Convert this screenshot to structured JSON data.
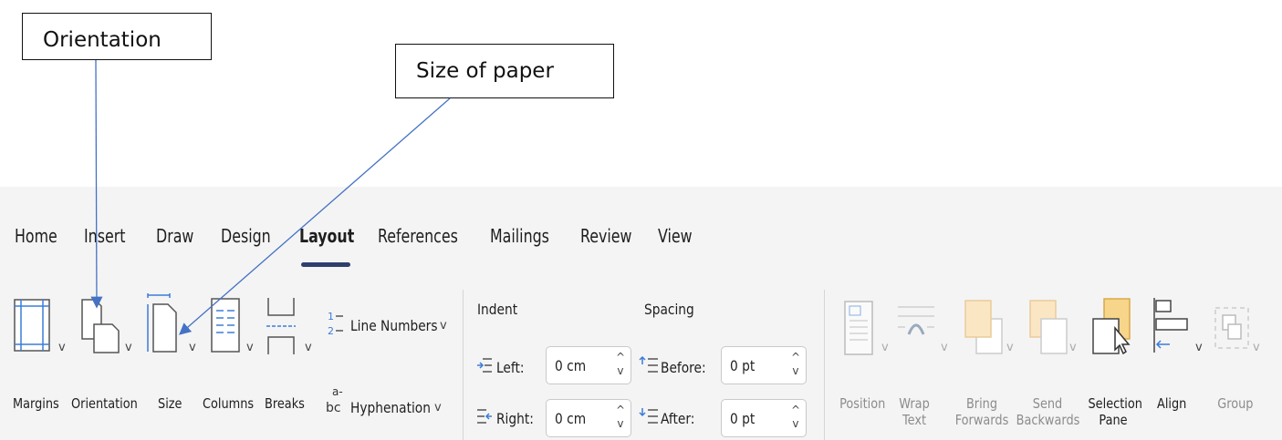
{
  "callouts": {
    "orientation": "Orientation",
    "size_of_paper": "Size of paper"
  },
  "tabs": [
    "Home",
    "Insert",
    "Draw",
    "Design",
    "Layout",
    "References",
    "Mailings",
    "Review",
    "View"
  ],
  "active_tab": "Layout",
  "page_setup": {
    "margins": "Margins",
    "orientation": "Orientation",
    "size": "Size",
    "columns": "Columns",
    "breaks": "Breaks",
    "line_numbers": "Line Numbers",
    "hyphenation": "Hyphenation"
  },
  "indent": {
    "heading": "Indent",
    "left_label": "Left:",
    "left_value": "0 cm",
    "right_label": "Right:",
    "right_value": "0 cm"
  },
  "spacing": {
    "heading": "Spacing",
    "before_label": "Before:",
    "before_value": "0 pt",
    "after_label": "After:",
    "after_value": "0 pt"
  },
  "arrange": {
    "position": "Position",
    "wrap_text_1": "Wrap",
    "wrap_text_2": "Text",
    "bring_forwards_1": "Bring",
    "bring_forwards_2": "Forwards",
    "send_backwards_1": "Send",
    "send_backwards_2": "Backwards",
    "selection_pane_1": "Selection",
    "selection_pane_2": "Pane",
    "align": "Align",
    "group": "Group"
  },
  "colors": {
    "accent_underline": "#2e3f6e",
    "arrow": "#4472c4",
    "icon_blue": "#3b7dd8",
    "selection_pane_fill": "#f7d58a"
  },
  "chevron": "v",
  "spin_glyph": "^"
}
